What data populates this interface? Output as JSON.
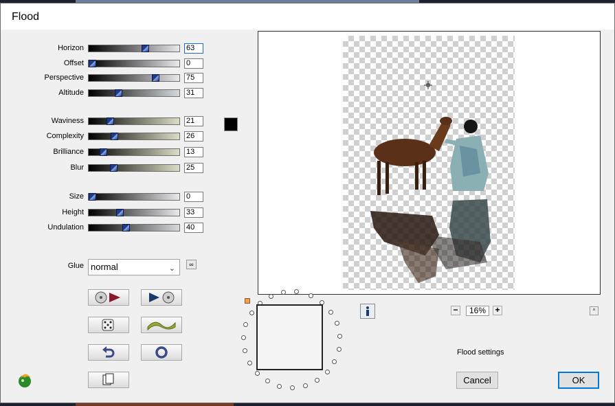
{
  "window": {
    "title": "Flood"
  },
  "groups": [
    [
      {
        "name": "horizon",
        "label": "Horizon",
        "value": "63",
        "level": 63,
        "focus": true,
        "grad": "g1"
      },
      {
        "name": "offset",
        "label": "Offset",
        "value": "0",
        "level": 0,
        "grad": "g1"
      },
      {
        "name": "perspective",
        "label": "Perspective",
        "value": "75",
        "level": 75,
        "grad": "g1"
      },
      {
        "name": "altitude",
        "label": "Altitude",
        "value": "31",
        "level": 31,
        "grad": "g3"
      }
    ],
    [
      {
        "name": "waviness",
        "label": "Waviness",
        "value": "21",
        "level": 21,
        "grad": "g2"
      },
      {
        "name": "complexity",
        "label": "Complexity",
        "value": "26",
        "level": 26,
        "grad": "g2"
      },
      {
        "name": "brilliance",
        "label": "Brilliance",
        "value": "13",
        "level": 13,
        "grad": "g2"
      },
      {
        "name": "blur",
        "label": "Blur",
        "value": "25",
        "level": 25,
        "grad": "g2"
      }
    ],
    [
      {
        "name": "size",
        "label": "Size",
        "value": "0",
        "level": 0,
        "grad": "g1"
      },
      {
        "name": "height",
        "label": "Height",
        "value": "33",
        "level": 33,
        "grad": "g1"
      },
      {
        "name": "undulation",
        "label": "Undulation",
        "value": "40",
        "level": 40,
        "grad": "g3"
      }
    ]
  ],
  "color_swatch": "#000000",
  "glue": {
    "label": "Glue",
    "value": "normal"
  },
  "toolbar_icons": [
    "disc-play-icon",
    "play-disc-icon",
    "dice-icon",
    "wave-icon",
    "undo-icon",
    "reset-icon",
    "copy-icon"
  ],
  "zoom": {
    "value": "16%",
    "minus": "−",
    "plus": "+"
  },
  "status": {
    "settings_label": "Flood settings"
  },
  "buttons": {
    "cancel": "Cancel",
    "ok": "OK"
  },
  "colors": {
    "accent": "#0078d7",
    "thumb": "#1e3a8a"
  }
}
